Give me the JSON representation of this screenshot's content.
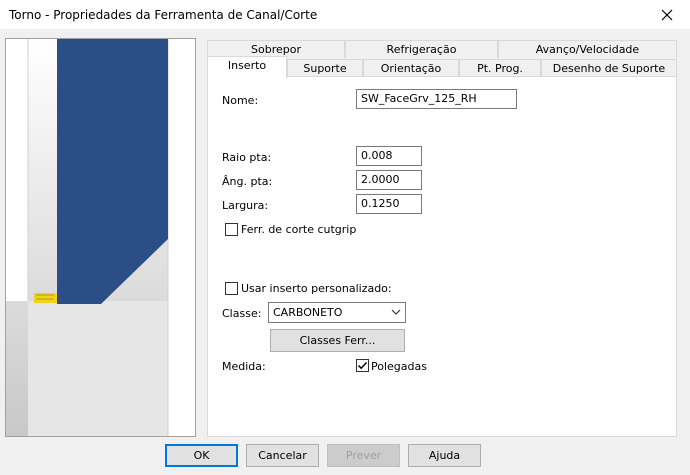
{
  "window": {
    "title": "Torno - Propriedades da Ferramenta de Canal/Corte",
    "close_icon": "close-icon"
  },
  "tabs": {
    "row_back": [
      {
        "label": "Sobrepor"
      },
      {
        "label": "Refrigeração"
      },
      {
        "label": "Avanço/Velocidade"
      }
    ],
    "row_front": [
      {
        "label": "Inserto",
        "active": true
      },
      {
        "label": "Suporte"
      },
      {
        "label": "Orientação"
      },
      {
        "label": "Pt. Prog."
      },
      {
        "label": "Desenho de Suporte"
      }
    ]
  },
  "form": {
    "name_label": "Nome:",
    "name_value": "SW_FaceGrv_125_RH",
    "radius_label": "Raio pta:",
    "radius_value": "0.008",
    "angle_label": "Âng. pta:",
    "angle_value": "2.0000",
    "width_label": "Largura:",
    "width_value": "0.1250",
    "cutgrip_label": "Ferr. de corte cutgrip",
    "cutgrip_checked": false,
    "custom_insert_label": "Usar inserto personalizado:",
    "custom_insert_checked": false,
    "class_label": "Classe:",
    "class_value": "CARBONETO",
    "tool_classes_button": "Classes Ferr...",
    "unit_label": "Medida:",
    "inches_label": "Polegadas",
    "inches_checked": true
  },
  "buttons": {
    "ok": "OK",
    "cancel": "Cancelar",
    "preview": "Prever",
    "help": "Ajuda"
  },
  "colors": {
    "tool_body": "#2b4e86",
    "insert_tip": "#f2d21b",
    "focus_border": "#0078d7"
  }
}
